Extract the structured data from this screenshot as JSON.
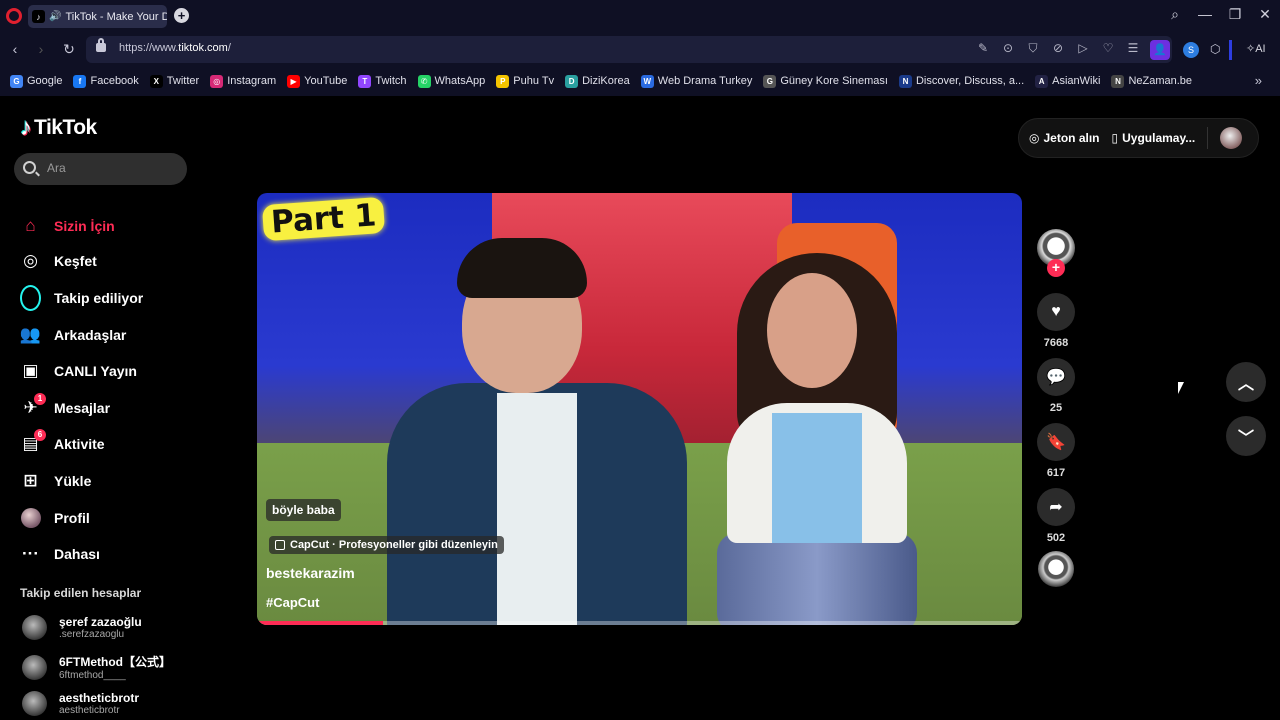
{
  "browser": {
    "tab_title": "TikTok - Make Your Da",
    "url_prefix": "https://www.",
    "url_domain": "tiktok.com",
    "url_suffix": "/",
    "bookmarks": [
      {
        "label": "Google",
        "icon": "G",
        "color": "#4285f4"
      },
      {
        "label": "Facebook",
        "icon": "f",
        "color": "#1877f2"
      },
      {
        "label": "Twitter",
        "icon": "X",
        "color": "#000000"
      },
      {
        "label": "Instagram",
        "icon": "◎",
        "color": "#d62976"
      },
      {
        "label": "YouTube",
        "icon": "▶",
        "color": "#ff0000"
      },
      {
        "label": "Twitch",
        "icon": "T",
        "color": "#9146ff"
      },
      {
        "label": "WhatsApp",
        "icon": "✆",
        "color": "#25d366"
      },
      {
        "label": "Puhu Tv",
        "icon": "P",
        "color": "#f5c400"
      },
      {
        "label": "DiziKorea",
        "icon": "D",
        "color": "#2aa0a0"
      },
      {
        "label": "Web Drama Turkey",
        "icon": "W",
        "color": "#2a6ae0"
      },
      {
        "label": "Güney Kore Sineması",
        "icon": "G",
        "color": "#555555"
      },
      {
        "label": "Discover, Discuss, a...",
        "icon": "N",
        "color": "#1a3a8a"
      },
      {
        "label": "AsianWiki",
        "icon": "A",
        "color": "#222244"
      },
      {
        "label": "NeZaman.be",
        "icon": "N",
        "color": "#444444"
      }
    ]
  },
  "sidebar": {
    "logo_text": "TikTok",
    "search_placeholder": "Ara",
    "nav": [
      {
        "label": "Sizin İçin",
        "icon": "home-icon",
        "glyph": "⌂"
      },
      {
        "label": "Keşfet",
        "icon": "compass-icon",
        "glyph": "◎"
      },
      {
        "label": "Takip ediliyor",
        "icon": "following-icon",
        "glyph": ""
      },
      {
        "label": "Arkadaşlar",
        "icon": "friends-icon",
        "glyph": "👥"
      },
      {
        "label": "CANLI Yayın",
        "icon": "live-icon",
        "glyph": "▣"
      },
      {
        "label": "Mesajlar",
        "icon": "messages-icon",
        "glyph": "✈",
        "badge": "1"
      },
      {
        "label": "Aktivite",
        "icon": "activity-icon",
        "glyph": "▤",
        "badge": "6"
      },
      {
        "label": "Yükle",
        "icon": "upload-icon",
        "glyph": "⊞"
      },
      {
        "label": "Profil",
        "icon": "profile-icon",
        "glyph": ""
      },
      {
        "label": "Dahası",
        "icon": "more-icon",
        "glyph": "···"
      }
    ],
    "following_title": "Takip edilen hesaplar",
    "accounts": [
      {
        "name": "şeref zazaoğlu",
        "user": ".serefzazaoglu"
      },
      {
        "name": "6FTMethod【公式】",
        "user": "6ftmethod____"
      },
      {
        "name": "aestheticbrotr",
        "user": "aestheticbrotr"
      }
    ]
  },
  "header": {
    "coins_label": "Jeton alın",
    "app_label": "Uygulamay..."
  },
  "video": {
    "overlay_text": "Part 1",
    "tag_text": "böyle baba",
    "capcut_text": "CapCut · Profesyoneller gibi düzenleyin",
    "author": "bestekarazim",
    "hashtag": "#CapCut",
    "progress": 0.165
  },
  "actions": {
    "likes": "7668",
    "comments": "25",
    "saves": "617",
    "shares": "502"
  },
  "colors": {
    "accent": "#fe2c55",
    "cyan": "#25f4ee"
  }
}
